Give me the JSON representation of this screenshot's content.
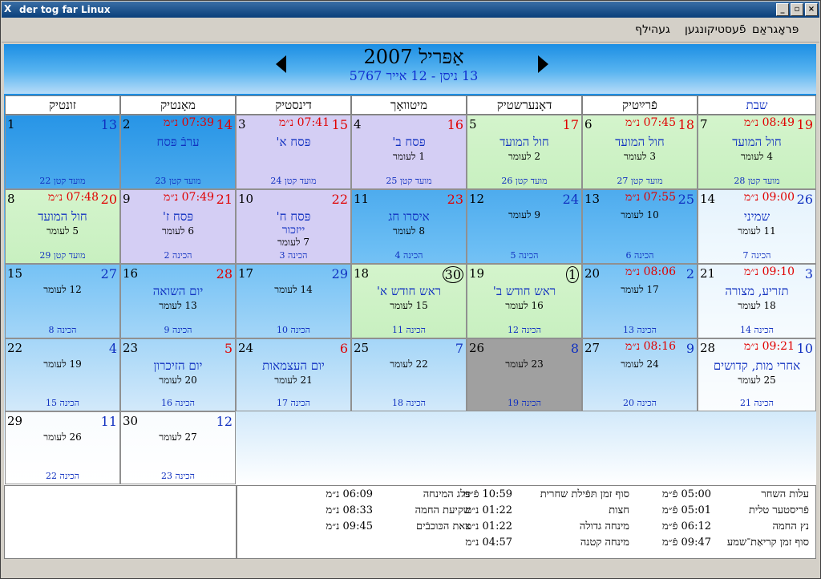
{
  "window": {
    "title": "der tog far Linux",
    "logo": "X-logo-icon"
  },
  "menu": {
    "items": [
      "פּראָגראַם",
      "פֿעסטיקונגען",
      "געהילף"
    ]
  },
  "header": {
    "month_title": "אַפּריל 2007",
    "hebrew_range": "13 ניסן - 12 אייר 5767"
  },
  "weekdays": [
    "שבת",
    "פֿרײַטיק",
    "דאָנערשטיק",
    "מיטוואָך",
    "דינסטיק",
    "מאָנטיק",
    "זונטיק"
  ],
  "cells": [
    {
      "g": "1",
      "h": "13",
      "hc": "#1030c0",
      "time": "",
      "hol": "",
      "hol2": "",
      "omer": "",
      "bottom": "מועד קטן 22",
      "bg": "blue"
    },
    {
      "g": "2",
      "h": "14",
      "hc": "#e00000",
      "time": "07:39 נ״מ",
      "hol": "ערבֿ פּסח",
      "hol2": "",
      "omer": "",
      "bottom": "מועד קטן 23",
      "bg": "blue"
    },
    {
      "g": "3",
      "h": "15",
      "hc": "#e00000",
      "time": "07:41 נ״מ",
      "hol": "פּסח א'",
      "hol2": "",
      "omer": "",
      "bottom": "מועד קטן 24",
      "bg": "purple"
    },
    {
      "g": "4",
      "h": "16",
      "hc": "#e00000",
      "time": "",
      "hol": "פּסח ב'",
      "hol2": "",
      "omer": "1 לעומר",
      "bottom": "מועד קטן 25",
      "bg": "purple"
    },
    {
      "g": "5",
      "h": "17",
      "hc": "#e00000",
      "time": "",
      "hol": "חול המועד",
      "hol2": "",
      "omer": "2 לעומר",
      "bottom": "מועד קטן 26",
      "bg": "holiday"
    },
    {
      "g": "6",
      "h": "18",
      "hc": "#e00000",
      "time": "07:45 נ״מ",
      "hol": "חול המועד",
      "hol2": "",
      "omer": "3 לעומר",
      "bottom": "מועד קטן 27",
      "bg": "holiday"
    },
    {
      "g": "7",
      "h": "19",
      "hc": "#e00000",
      "time": "08:49 נ״מ",
      "hol": "חול המועד",
      "hol2": "",
      "omer": "4 לעומר",
      "bottom": "מועד קטן 28",
      "bg": "holiday"
    },
    {
      "g": "8",
      "h": "20",
      "hc": "#e00000",
      "time": "07:48 נ״מ",
      "hol": "חול המועד",
      "hol2": "",
      "omer": "5 לעומר",
      "bottom": "מועד קטן 29",
      "bg": "holiday"
    },
    {
      "g": "9",
      "h": "21",
      "hc": "#e00000",
      "time": "07:49 נ״מ",
      "hol": "פּסח ז'",
      "hol2": "",
      "omer": "6 לעומר",
      "bottom": "הכינה 2",
      "bg": "purple"
    },
    {
      "g": "10",
      "h": "22",
      "hc": "#e00000",
      "time": "",
      "hol": "פּסח ח'",
      "hol2": "ייזכור",
      "omer": "7 לעומר",
      "bottom": "הכינה 3",
      "bg": "purple"
    },
    {
      "g": "11",
      "h": "23",
      "hc": "#e00000",
      "time": "",
      "hol": "איסרו חג",
      "hol2": "",
      "omer": "8 לעומר",
      "bottom": "הכינה 4",
      "bg": "blue"
    },
    {
      "g": "12",
      "h": "24",
      "hc": "#1030c0",
      "time": "",
      "hol": "",
      "hol2": "",
      "omer": "9 לעומר",
      "bottom": "הכינה 5",
      "bg": "blue"
    },
    {
      "g": "13",
      "h": "25",
      "hc": "#1030c0",
      "time": "07:55 נ״מ",
      "hol": "",
      "hol2": "",
      "omer": "10 לעומר",
      "bottom": "הכינה 6",
      "bg": "blue"
    },
    {
      "g": "14",
      "h": "26",
      "hc": "#1030c0",
      "time": "09:00 נ״מ",
      "hol": "שמיני",
      "hol2": "",
      "omer": "11 לעומר",
      "bottom": "הכינה 7",
      "bg": "white"
    },
    {
      "g": "15",
      "h": "27",
      "hc": "#1030c0",
      "time": "",
      "hol": "",
      "hol2": "",
      "omer": "12 לעומר",
      "bottom": "הכינה 8",
      "bg": "blue"
    },
    {
      "g": "16",
      "h": "28",
      "hc": "#e00000",
      "time": "",
      "hol": "יום השואה",
      "hol2": "",
      "omer": "13 לעומר",
      "bottom": "הכינה 9",
      "bg": "blue"
    },
    {
      "g": "17",
      "h": "29",
      "hc": "#1030c0",
      "time": "",
      "hol": "",
      "hol2": "",
      "omer": "14 לעומר",
      "bottom": "הכינה 10",
      "bg": "blue"
    },
    {
      "g": "18",
      "h": "30",
      "hc": "#000000",
      "time": "",
      "hol": "ראש חודש א'",
      "hol2": "",
      "omer": "15 לעומר",
      "bottom": "הכינה 11",
      "bg": "holiday",
      "circle": true
    },
    {
      "g": "19",
      "h": "1",
      "hc": "#000000",
      "time": "",
      "hol": "ראש חודש ב'",
      "hol2": "",
      "omer": "16 לעומר",
      "bottom": "הכינה 12",
      "bg": "holiday",
      "circle": true
    },
    {
      "g": "20",
      "h": "2",
      "hc": "#1030c0",
      "time": "08:06 נ״מ",
      "hol": "",
      "hol2": "",
      "omer": "17 לעומר",
      "bottom": "הכינה 13",
      "bg": "blue"
    },
    {
      "g": "21",
      "h": "3",
      "hc": "#1030c0",
      "time": "09:10 נ״מ",
      "hol": "תזריע, מצורה",
      "hol2": "",
      "omer": "18 לעומר",
      "bottom": "הכינה 14",
      "bg": "white"
    },
    {
      "g": "22",
      "h": "4",
      "hc": "#1030c0",
      "time": "",
      "hol": "",
      "hol2": "",
      "omer": "19 לעומר",
      "bottom": "הכינה 15",
      "bg": "blue"
    },
    {
      "g": "23",
      "h": "5",
      "hc": "#e00000",
      "time": "",
      "hol": "יום הזיכרון",
      "hol2": "",
      "omer": "20 לעומר",
      "bottom": "הכינה 16",
      "bg": "blue"
    },
    {
      "g": "24",
      "h": "6",
      "hc": "#e00000",
      "time": "",
      "hol": "יום העצמאות",
      "hol2": "",
      "omer": "21 לעומר",
      "bottom": "הכינה 17",
      "bg": "blue"
    },
    {
      "g": "25",
      "h": "7",
      "hc": "#1030c0",
      "time": "",
      "hol": "",
      "hol2": "",
      "omer": "22 לעומר",
      "bottom": "הכינה 18",
      "bg": "blue"
    },
    {
      "g": "26",
      "h": "8",
      "hc": "#1030c0",
      "time": "",
      "hol": "",
      "hol2": "",
      "omer": "23 לעומר",
      "bottom": "הכינה 19",
      "bg": "today"
    },
    {
      "g": "27",
      "h": "9",
      "hc": "#1030c0",
      "time": "08:16 נ״מ",
      "hol": "",
      "hol2": "",
      "omer": "24 לעומר",
      "bottom": "הכינה 20",
      "bg": "blue"
    },
    {
      "g": "28",
      "h": "10",
      "hc": "#1030c0",
      "time": "09:21 נ״מ",
      "hol": "אחרי מות, קדושים",
      "hol2": "",
      "omer": "25 לעומר",
      "bottom": "הכינה 21",
      "bg": "white"
    },
    {
      "g": "29",
      "h": "11",
      "hc": "#1030c0",
      "time": "",
      "hol": "",
      "hol2": "",
      "omer": "26 לעומר",
      "bottom": "הכינה 22",
      "bg": "white"
    },
    {
      "g": "30",
      "h": "12",
      "hc": "#1030c0",
      "time": "",
      "hol": "",
      "hol2": "",
      "omer": "27 לעומר",
      "bottom": "הכינה 23",
      "bg": "white"
    }
  ],
  "zmanim": {
    "col1": [
      {
        "label": "עלות השחר",
        "value": "05:00 פֿ״מ"
      },
      {
        "label": "פֿריסטער טלית",
        "value": "05:01 פֿ״מ"
      },
      {
        "label": "נץ החמה",
        "value": "06:12 פֿ״מ"
      },
      {
        "label": "סוף זמן קריאַת־שמע",
        "value": "09:47 פֿ״מ"
      }
    ],
    "col2": [
      {
        "label": "סוף זמן תּפֿילת שחרית",
        "value": "10:59 פֿ״מ"
      },
      {
        "label": "חצות",
        "value": "01:22 נ״מ"
      },
      {
        "label": "מינחה גדולה",
        "value": "01:22 נ״מ"
      },
      {
        "label": "מינחה קטנה",
        "value": "04:57 נ״מ"
      }
    ],
    "col3": [
      {
        "label": "פּלג המינחה",
        "value": "06:09 נ״מ"
      },
      {
        "label": "שקיעת החמה",
        "value": "08:33 נ״מ"
      },
      {
        "label": "צאת הכּוכבֿים",
        "value": "09:45 נ״מ"
      }
    ]
  },
  "colors": {
    "red": "#e00000",
    "blue": "#1030c0",
    "holiday_green": "#c8f0c0",
    "purple": "#d4cef4",
    "today_gray": "#a0a0a0"
  }
}
